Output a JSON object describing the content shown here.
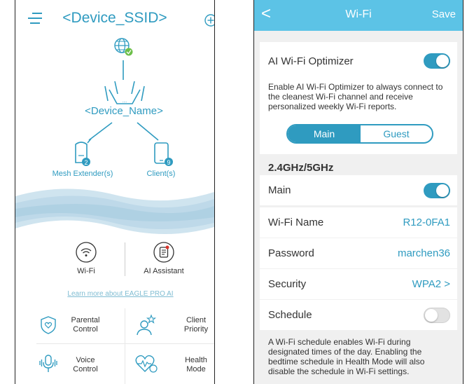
{
  "left_screen": {
    "title": "<Device_SSID>",
    "menu_icon": "hamburger-menu-icon",
    "add_icon": "add-circle-icon",
    "device_name": "<Device_Name>",
    "mesh_extender": {
      "label": "Mesh Extender(s)",
      "count": "2"
    },
    "clients": {
      "label": "Client(s)",
      "count": "9"
    },
    "router_dots": "....",
    "features": [
      {
        "label": "Wi-Fi",
        "icon": "wifi-icon"
      },
      {
        "label": "AI Assistant",
        "icon": "ai-assistant-icon"
      }
    ],
    "learn_more": "Learn more about EAGLE PRO AI",
    "grid": [
      {
        "label": "Parental Control",
        "line1": "Parental",
        "line2": "Control",
        "icon": "shield-heart-icon"
      },
      {
        "label": "Client Priority",
        "line1": "Client",
        "line2": "Priority",
        "icon": "client-priority-icon"
      },
      {
        "label": "Voice Control",
        "line1": "Voice",
        "line2": "Control",
        "icon": "microphone-icon"
      },
      {
        "label": "Health Mode",
        "line1": "Health",
        "line2": "Mode",
        "icon": "health-heart-icon"
      }
    ],
    "accent_color": "#2f9bc0"
  },
  "right_screen": {
    "title": "Wi-Fi",
    "back": "<",
    "save": "Save",
    "ai_optimizer": {
      "label": "AI Wi-Fi Optimizer",
      "enabled": true,
      "description": "Enable AI Wi-Fi Optimizer to always connect to the cleanest Wi-Fi channel and receive personalized weekly Wi-Fi reports."
    },
    "tabs": [
      "Main",
      "Guest"
    ],
    "selected_tab": "Main",
    "band_heading": "2.4GHz/5GHz",
    "main_toggle": {
      "label": "Main",
      "enabled": true
    },
    "wifi_name": {
      "label": "Wi-Fi Name",
      "value": "R12-0FA1"
    },
    "password": {
      "label": "Password",
      "value": "marchen36"
    },
    "security": {
      "label": "Security",
      "value": "WPA2 >"
    },
    "schedule": {
      "label": "Schedule",
      "enabled": false,
      "note": "A Wi-Fi schedule enables Wi-Fi during designated times of the day. Enabling the bedtime schedule in Health Mode will also disable the schedule in Wi-Fi settings."
    },
    "header_color": "#5cc3e6"
  }
}
